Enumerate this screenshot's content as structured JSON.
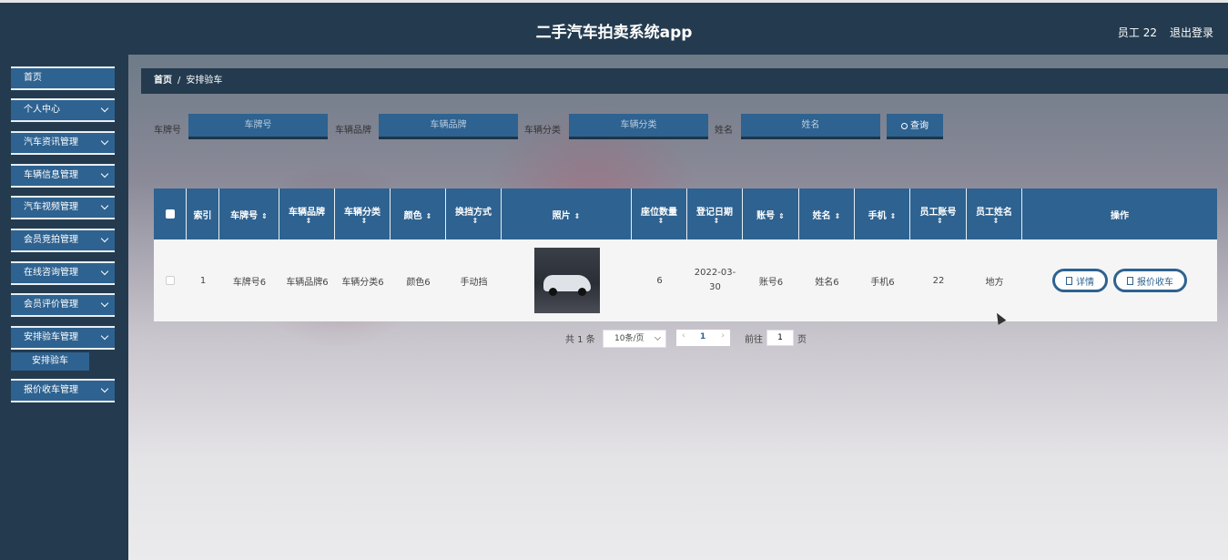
{
  "header": {
    "title": "二手汽车拍卖系统app",
    "user": "员工 22",
    "logout": "退出登录"
  },
  "sidebar": {
    "items": [
      {
        "label": "首页",
        "has_children": false
      },
      {
        "label": "个人中心",
        "has_children": true
      },
      {
        "label": "汽车资讯管理",
        "has_children": true
      },
      {
        "label": "车辆信息管理",
        "has_children": true
      },
      {
        "label": "汽车视频管理",
        "has_children": true
      },
      {
        "label": "会员竞拍管理",
        "has_children": true
      },
      {
        "label": "在线咨询管理",
        "has_children": true
      },
      {
        "label": "会员评价管理",
        "has_children": true
      },
      {
        "label": "安排验车管理",
        "has_children": true
      },
      {
        "label": "报价收车管理",
        "has_children": true
      }
    ],
    "sub_item": "安排验车"
  },
  "breadcrumb": {
    "home": "首页",
    "separator": "/",
    "current": "安排验车"
  },
  "search": {
    "plate_label": "车牌号",
    "plate_placeholder": "车牌号",
    "brand_label": "车辆品牌",
    "brand_placeholder": "车辆品牌",
    "category_label": "车辆分类",
    "category_placeholder": "车辆分类",
    "name_label": "姓名",
    "name_placeholder": "姓名",
    "button": "查询"
  },
  "table": {
    "headers": [
      "索引",
      "车牌号",
      "车辆品牌",
      "车辆分类",
      "颜色",
      "换挡方式",
      "照片",
      "座位数量",
      "登记日期",
      "账号",
      "姓名",
      "手机",
      "员工账号",
      "员工姓名",
      "操作"
    ],
    "rows": [
      {
        "index": "1",
        "plate": "车牌号6",
        "brand": "车辆品牌6",
        "category": "车辆分类6",
        "color": "颜色6",
        "transmission": "手动挡",
        "seats": "6",
        "date_line1": "2022-03-",
        "date_line2": "30",
        "account": "账号6",
        "name": "姓名6",
        "phone": "手机6",
        "staff_account": "22",
        "staff_name": "地方"
      }
    ],
    "actions": {
      "detail": "详情",
      "quote": "报价收车"
    }
  },
  "pagination": {
    "total": "共 1 条",
    "page_size": "10条/页",
    "prev": "‹",
    "current": "1",
    "next": "›",
    "goto_label": "前往",
    "goto_value": "1",
    "page_suffix": "页"
  },
  "colors": {
    "header_bg": "#243b4f",
    "accent": "#2e6290"
  },
  "icons": [
    "chevron-down-icon",
    "search-icon",
    "sort-icon",
    "document-icon",
    "photo-car"
  ]
}
